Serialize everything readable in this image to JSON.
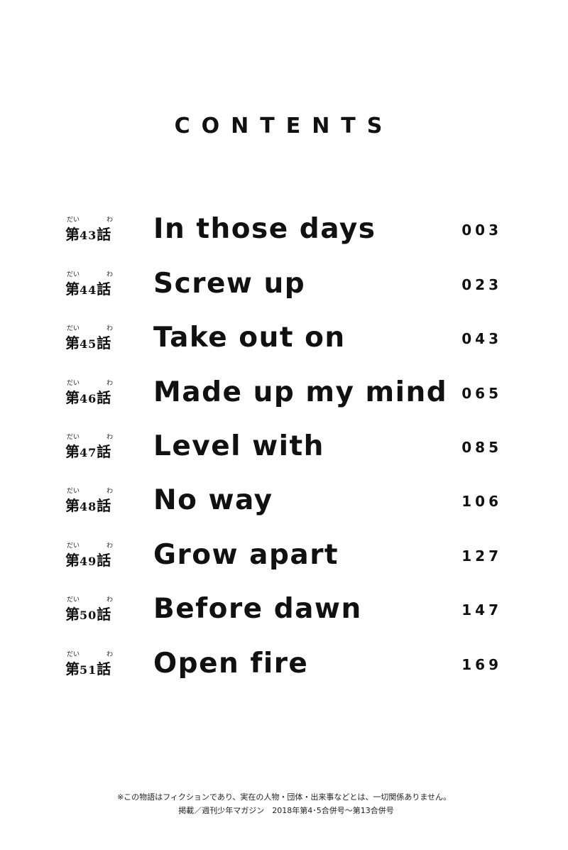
{
  "heading": "CONTENTS",
  "toc": [
    {
      "ruby_dai": "だい",
      "prefix": "第",
      "number": "43",
      "suffix": "話",
      "ruby_wa": "わ",
      "title": "In those days",
      "page": "003"
    },
    {
      "ruby_dai": "だい",
      "prefix": "第",
      "number": "44",
      "suffix": "話",
      "ruby_wa": "わ",
      "title": "Screw up",
      "page": "023"
    },
    {
      "ruby_dai": "だい",
      "prefix": "第",
      "number": "45",
      "suffix": "話",
      "ruby_wa": "わ",
      "title": "Take out on",
      "page": "043"
    },
    {
      "ruby_dai": "だい",
      "prefix": "第",
      "number": "46",
      "suffix": "話",
      "ruby_wa": "わ",
      "title": "Made up my mind",
      "page": "065"
    },
    {
      "ruby_dai": "だい",
      "prefix": "第",
      "number": "47",
      "suffix": "話",
      "ruby_wa": "わ",
      "title": "Level with",
      "page": "085"
    },
    {
      "ruby_dai": "だい",
      "prefix": "第",
      "number": "48",
      "suffix": "話",
      "ruby_wa": "わ",
      "title": "No way",
      "page": "106"
    },
    {
      "ruby_dai": "だい",
      "prefix": "第",
      "number": "49",
      "suffix": "話",
      "ruby_wa": "わ",
      "title": "Grow apart",
      "page": "127"
    },
    {
      "ruby_dai": "だい",
      "prefix": "第",
      "number": "50",
      "suffix": "話",
      "ruby_wa": "わ",
      "title": "Before dawn",
      "page": "147"
    },
    {
      "ruby_dai": "だい",
      "prefix": "第",
      "number": "51",
      "suffix": "話",
      "ruby_wa": "わ",
      "title": "Open fire",
      "page": "169"
    }
  ],
  "footer": {
    "disclaimer": "※この物語はフィクションであり、実在の人物・団体・出来事などとは、一切関係ありません。",
    "publication": "掲載／週刊少年マガジン　2018年第4･5合併号〜第13合併号"
  }
}
